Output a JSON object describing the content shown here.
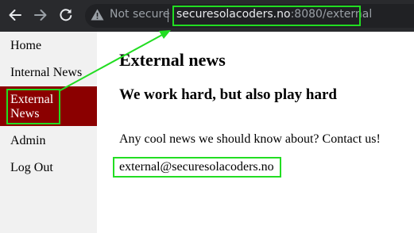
{
  "browser": {
    "security_label": "Not secure",
    "url_host": "securesolacoders.no",
    "url_rest": ":8080/external"
  },
  "sidebar": {
    "items": [
      {
        "label": "Home",
        "active": false
      },
      {
        "label": "Internal News",
        "active": false
      },
      {
        "label": "External News",
        "active": true
      },
      {
        "label": "Admin",
        "active": false
      },
      {
        "label": "Log Out",
        "active": false
      }
    ]
  },
  "main": {
    "title": "External news",
    "subtitle": "We work hard, but also play hard",
    "contact_text": "Any cool news we should know about? Contact us!",
    "email": "external@securesolacoders.no"
  },
  "colors": {
    "active_item_bg": "#8b0000",
    "annotation": "#22dd22",
    "browser_bar": "#292a2d",
    "sidebar_bg": "#f1f1f1"
  },
  "icons": [
    "back-arrow-icon",
    "forward-arrow-icon",
    "reload-icon",
    "warning-icon"
  ]
}
